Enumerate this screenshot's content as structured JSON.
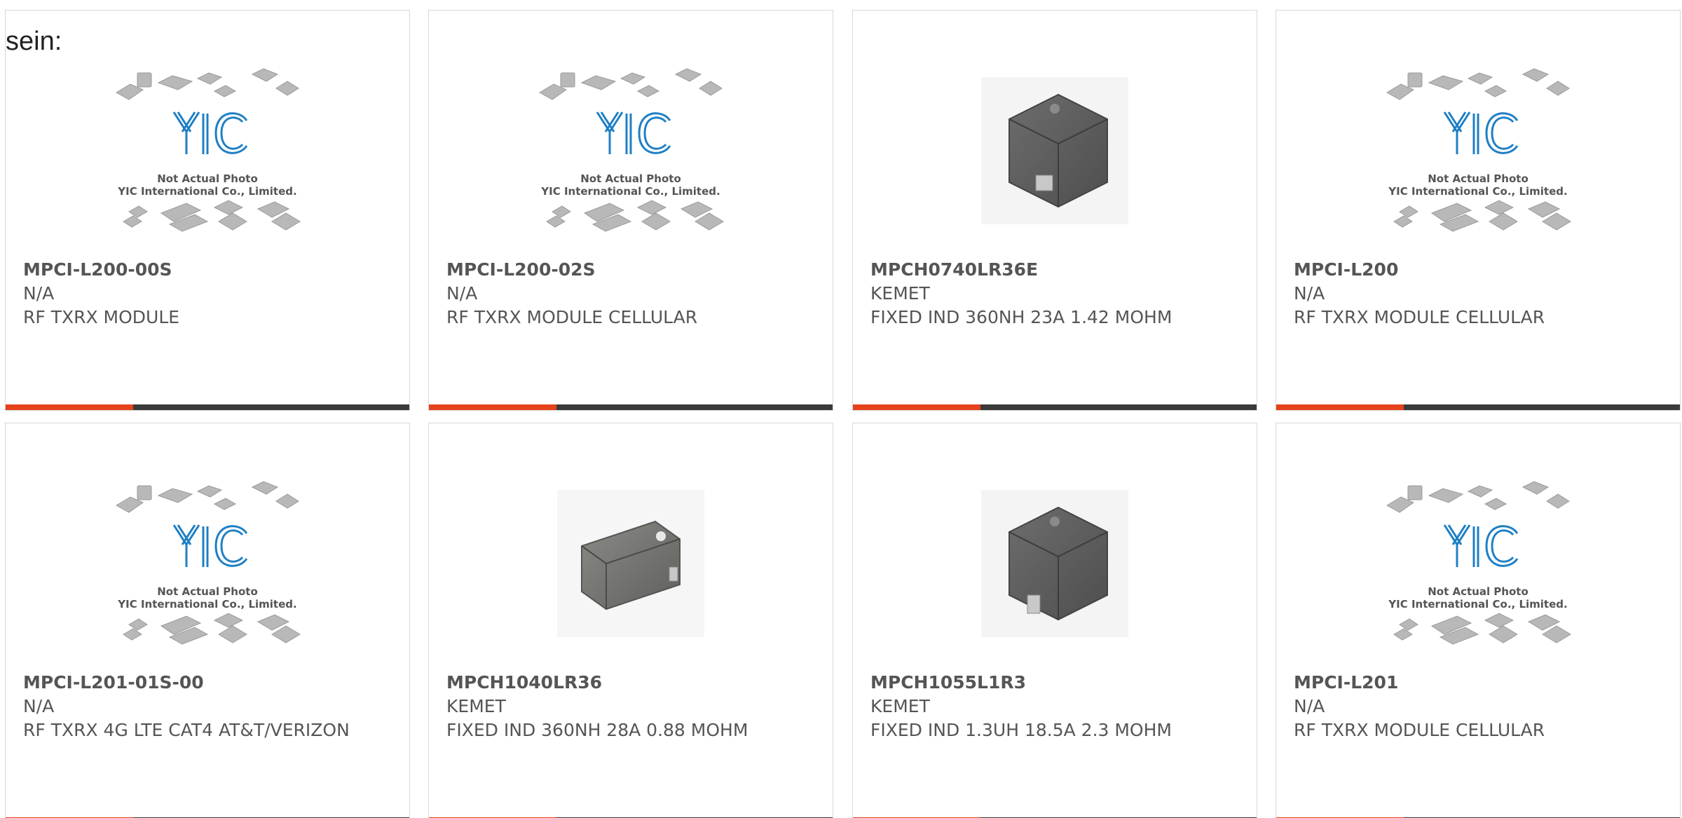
{
  "lead_text": "sein:",
  "placeholder": {
    "line1": "Not Actual Photo",
    "line2": "YIC International Co., Limited.",
    "logo": "YIC"
  },
  "colors": {
    "accent": "#e5421b",
    "bar": "#3a3a3a",
    "logo": "#1f7fc4",
    "text": "#555555"
  },
  "products": [
    {
      "part": "MPCI-L200-00S",
      "maker": "N/A",
      "desc": "RF TXRX MODULE",
      "image": "placeholder-logo"
    },
    {
      "part": "MPCI-L200-02S",
      "maker": "N/A",
      "desc": "RF TXRX MODULE CELLULAR",
      "image": "placeholder-logo"
    },
    {
      "part": "MPCH0740LR36E",
      "maker": "KEMET",
      "desc": "FIXED IND 360NH 23A 1.42 MOHM",
      "image": "inductor-photo"
    },
    {
      "part": "MPCI-L200",
      "maker": "N/A",
      "desc": "RF TXRX MODULE CELLULAR",
      "image": "placeholder-logo"
    },
    {
      "part": "MPCI-L201-01S-00",
      "maker": "N/A",
      "desc": "RF TXRX 4G LTE CAT4 AT&T/VERIZON",
      "image": "placeholder-logo"
    },
    {
      "part": "MPCH1040LR36",
      "maker": "KEMET",
      "desc": "FIXED IND 360NH 28A 0.88 MOHM",
      "image": "inductor-photo"
    },
    {
      "part": "MPCH1055L1R3",
      "maker": "KEMET",
      "desc": "FIXED IND 1.3UH 18.5A 2.3 MOHM",
      "image": "inductor-photo"
    },
    {
      "part": "MPCI-L201",
      "maker": "N/A",
      "desc": "RF TXRX MODULE CELLULAR",
      "image": "placeholder-logo"
    }
  ]
}
